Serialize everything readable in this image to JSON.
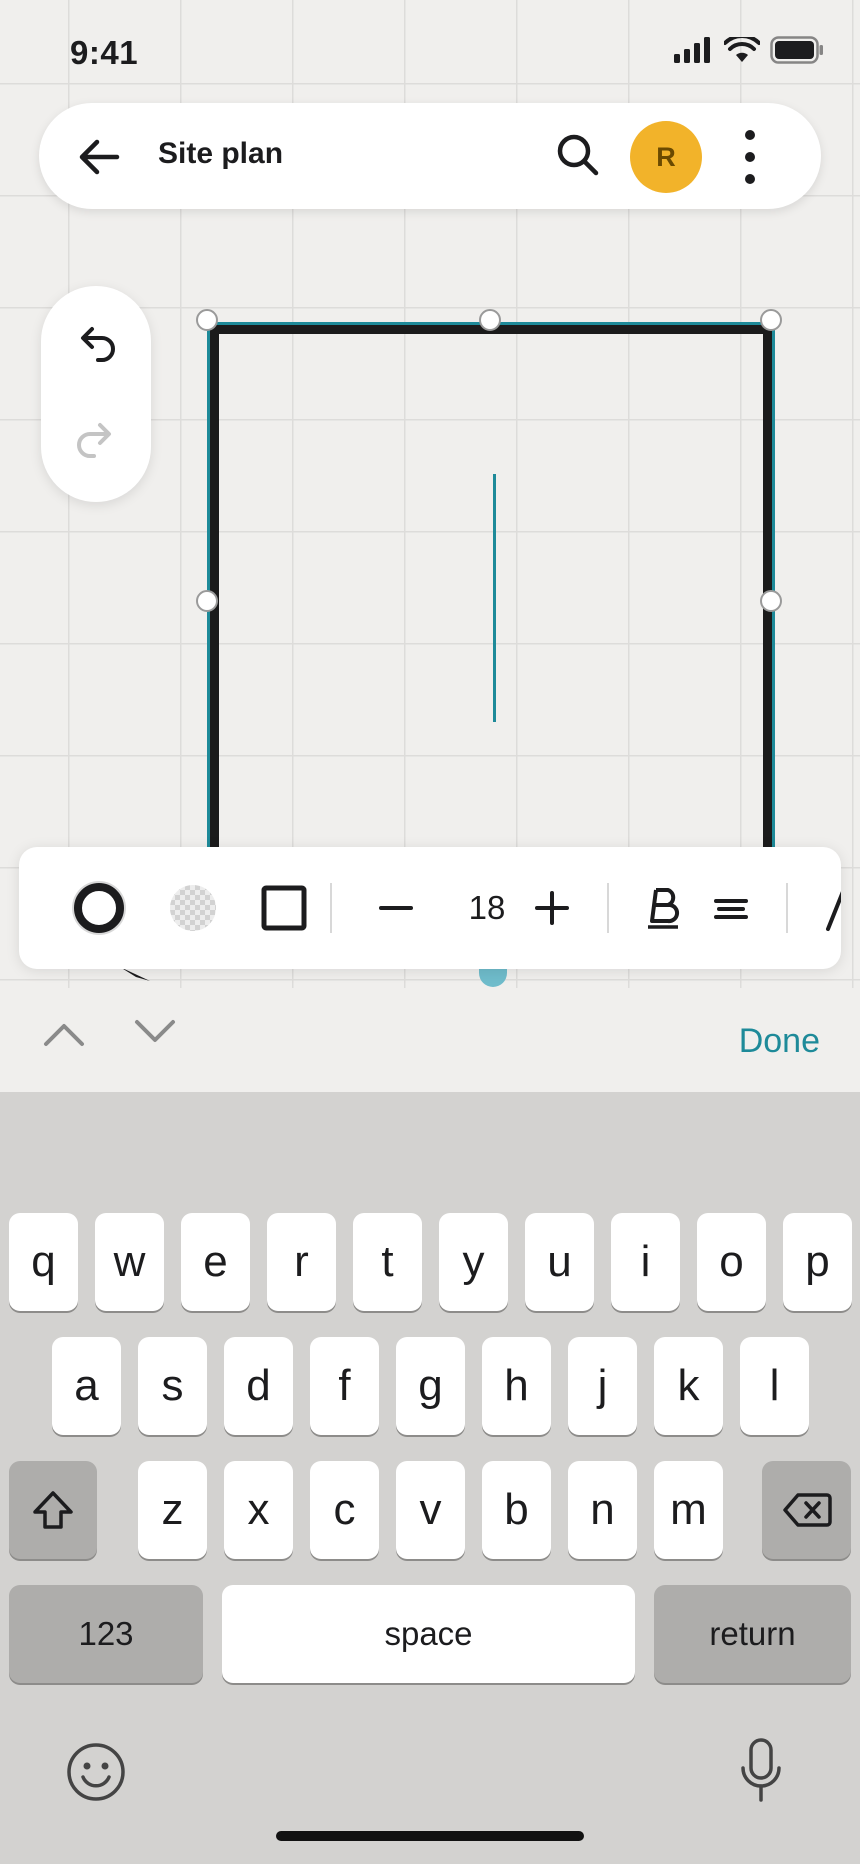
{
  "status": {
    "time": "9:41"
  },
  "app_bar": {
    "title": "Site plan",
    "avatar_initial": "R"
  },
  "format_toolbar": {
    "font_size": "18"
  },
  "accessory_bar": {
    "done_label": "Done"
  },
  "keyboard": {
    "row1": [
      "q",
      "w",
      "e",
      "r",
      "t",
      "y",
      "u",
      "i",
      "o",
      "p"
    ],
    "row2": [
      "a",
      "s",
      "d",
      "f",
      "g",
      "h",
      "j",
      "k",
      "l"
    ],
    "row3": [
      "z",
      "x",
      "c",
      "v",
      "b",
      "n",
      "m"
    ],
    "numbers_label": "123",
    "space_label": "space",
    "return_label": "return"
  },
  "colors": {
    "accent": "#1e8a99",
    "avatar": "#f2b32a"
  }
}
